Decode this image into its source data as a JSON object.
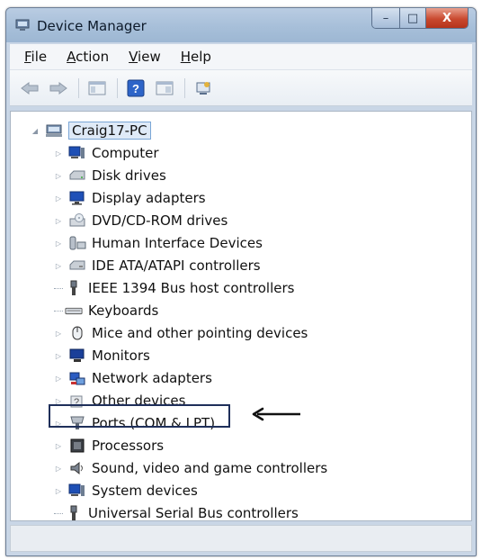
{
  "window": {
    "title": "Device Manager"
  },
  "caption_buttons": {
    "minimize": "–",
    "maximize": "□",
    "close": "X"
  },
  "menu": [
    {
      "underline": "F",
      "rest": "ile"
    },
    {
      "underline": "A",
      "rest": "ction"
    },
    {
      "underline": "V",
      "rest": "iew"
    },
    {
      "underline": "H",
      "rest": "elp"
    }
  ],
  "toolbar": [
    "back-icon",
    "forward-icon",
    "show-hide-console-tree-icon",
    "help-icon",
    "properties-icon",
    "scan-hardware-icon"
  ],
  "tree": {
    "root": "Craig17-PC",
    "items": [
      "Computer",
      "Disk drives",
      "Display adapters",
      "DVD/CD-ROM drives",
      "Human Interface Devices",
      "IDE ATA/ATAPI controllers",
      "IEEE 1394 Bus host controllers",
      "Keyboards",
      "Mice and other pointing devices",
      "Monitors",
      "Network adapters",
      "Other devices",
      "Ports (COM & LPT)",
      "Processors",
      "Sound, video and game controllers",
      "System devices",
      "Universal Serial Bus controllers"
    ]
  },
  "annotation": {
    "highlighted_item": "Ports (COM & LPT)",
    "arrow_direction": "left"
  }
}
